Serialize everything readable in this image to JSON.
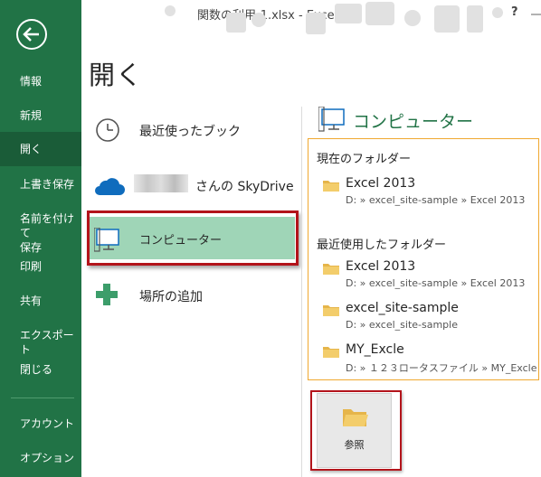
{
  "window": {
    "title": "関数の利用-1.xlsx - Excel",
    "help": "?"
  },
  "nav": {
    "items": [
      {
        "label": "情報"
      },
      {
        "label": "新規"
      },
      {
        "label": "開く"
      },
      {
        "label": "上書き保存"
      },
      {
        "label": "名前を付けて\n保存"
      },
      {
        "label": "印刷"
      },
      {
        "label": "共有"
      },
      {
        "label": "エクスポート"
      },
      {
        "label": "閉じる"
      },
      {
        "label": "アカウント"
      },
      {
        "label": "オプション"
      }
    ],
    "selected": "開く"
  },
  "page": {
    "title": "開く"
  },
  "places": {
    "recent": "最近使ったブック",
    "skydrive": "さんの SkyDrive",
    "computer": "コンピューター",
    "add_place": "場所の追加"
  },
  "right": {
    "heading": "コンピューター",
    "current_folder_label": "現在のフォルダー",
    "recent_folders_label": "最近使用したフォルダー",
    "current": [
      {
        "name": "Excel 2013",
        "path": "D: » excel_site-sample » Excel 2013"
      }
    ],
    "recent": [
      {
        "name": "Excel 2013",
        "path": "D: » excel_site-sample » Excel 2013"
      },
      {
        "name": "excel_site-sample",
        "path": "D: » excel_site-sample"
      },
      {
        "name": "MY_Excle",
        "path": "D: » １２３ロータスファイル » MY_Excle"
      }
    ],
    "browse": "参照"
  },
  "colors": {
    "nav_bg": "#217346",
    "nav_selected": "#1a5c38",
    "accent": "#217346",
    "place_selected": "#9fd5b7",
    "highlight_red": "#b3141b",
    "highlight_orange": "#f0a830",
    "folder": "#e6b54a"
  }
}
